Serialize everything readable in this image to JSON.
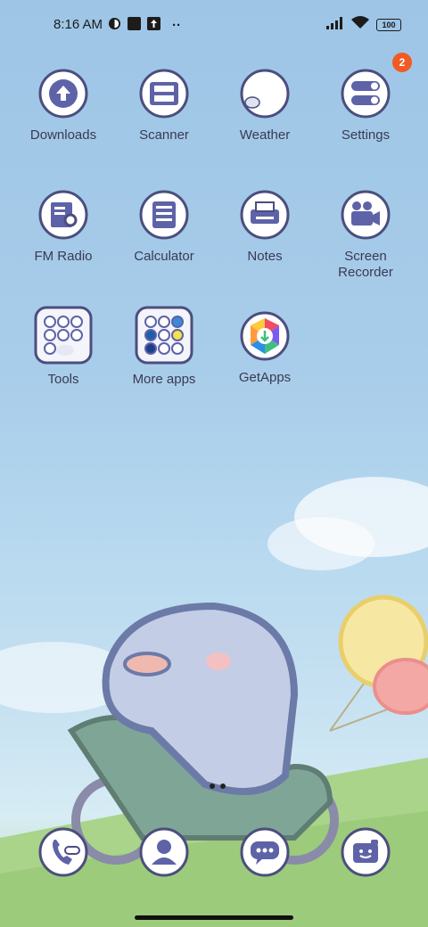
{
  "status_bar": {
    "time": "8:16 AM",
    "battery": "100"
  },
  "apps": [
    {
      "label": "Downloads",
      "icon": "downloads-icon"
    },
    {
      "label": "Scanner",
      "icon": "scanner-icon"
    },
    {
      "label": "Weather",
      "icon": "weather-icon"
    },
    {
      "label": "Settings",
      "icon": "settings-icon",
      "badge": "2"
    },
    {
      "label": "FM Radio",
      "icon": "fm-radio-icon"
    },
    {
      "label": "Calculator",
      "icon": "calculator-icon"
    },
    {
      "label": "Notes",
      "icon": "notes-icon"
    },
    {
      "label": "Screen\nRecorder",
      "icon": "screen-recorder-icon"
    },
    {
      "label": "Tools",
      "icon": "folder-icon"
    },
    {
      "label": "More apps",
      "icon": "folder-icon"
    },
    {
      "label": "GetApps",
      "icon": "getapps-icon"
    }
  ],
  "dock": [
    {
      "icon": "phone-icon"
    },
    {
      "icon": "contacts-icon"
    },
    {
      "icon": "messages-icon"
    },
    {
      "icon": "camera-icon"
    }
  ],
  "colors": {
    "icon_fill": "#5e63a8",
    "icon_bg": "#ffffff",
    "badge": "#f15a24",
    "label": "#3a3a52"
  }
}
